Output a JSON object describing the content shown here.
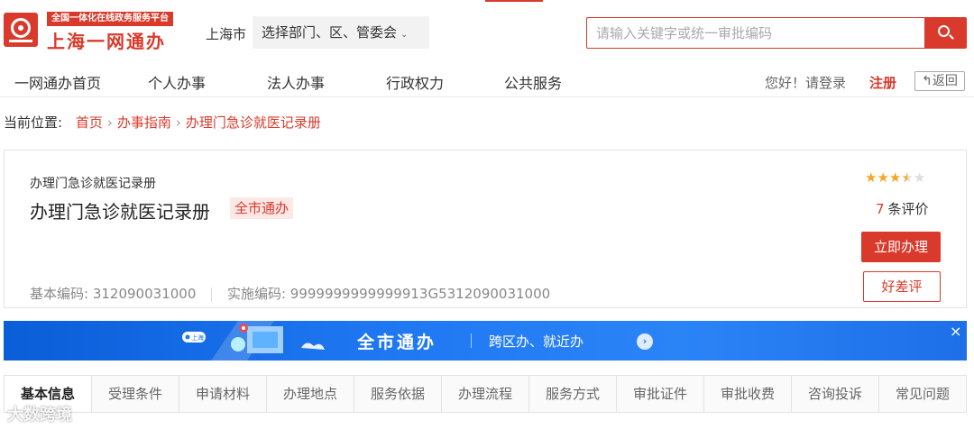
{
  "header": {
    "logo_tag": "全国一体化在线政务服务平台",
    "logo_name": "上海一网通办",
    "city": "上海市",
    "dept_select": "选择部门、区、管委会",
    "search_placeholder": "请输入关键字或统一审批编码",
    "icons": {
      "logo": "shanghai-logo-icon",
      "search": "search-icon",
      "dropdown": "chevron-down-icon"
    }
  },
  "nav": {
    "items": [
      "一网通办首页",
      "个人办事",
      "法人办事",
      "行政权力",
      "公共服务"
    ],
    "greeting": "您好！请登录",
    "register": "注册",
    "back": "返回"
  },
  "breadcrumb": {
    "label": "当前位置:",
    "items": [
      "首页",
      "办事指南",
      "办理门急诊就医记录册"
    ]
  },
  "service": {
    "subtitle": "办理门急诊就医记录册",
    "title": "办理门急诊就医记录册",
    "badge": "全市通办",
    "basic_code_label": "基本编码:",
    "basic_code": "312090031000",
    "impl_code_label": "实施编码:",
    "impl_code": "9999999999999913G5312090031000",
    "rating": 3.5,
    "rating_max": 5,
    "review_count": "7",
    "review_label": "条评价",
    "apply_button": "立即办理",
    "rate_button": "好差评"
  },
  "banner": {
    "title": "全市通办",
    "subtitle": "跨区办、就近办",
    "close": "×",
    "art_tag": "上海"
  },
  "tabs": {
    "items": [
      "基本信息",
      "受理条件",
      "申请材料",
      "办理地点",
      "服务依据",
      "办理流程",
      "服务方式",
      "审批证件",
      "审批收费",
      "咨询投诉",
      "常见问题"
    ],
    "active_index": 0
  },
  "watermark": "大数跨境",
  "colors": {
    "accent": "#d93a2b",
    "banner_blue": "#1f78f2",
    "star": "#f5a623"
  }
}
